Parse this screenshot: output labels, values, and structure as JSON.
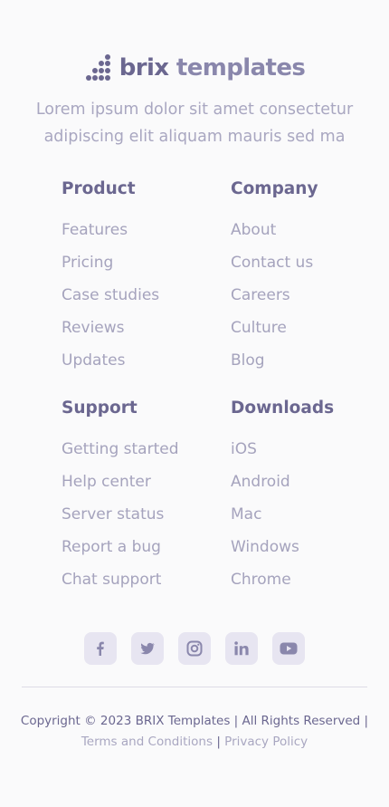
{
  "brand": {
    "word1": "brix",
    "word2": "templates"
  },
  "description": "Lorem ipsum dolor sit amet consectetur adipiscing elit aliquam mauris sed ma",
  "columns": [
    {
      "title": "Product",
      "links": [
        "Features",
        "Pricing",
        "Case studies",
        "Reviews",
        "Updates"
      ]
    },
    {
      "title": "Company",
      "links": [
        "About",
        "Contact us",
        "Careers",
        "Culture",
        "Blog"
      ]
    },
    {
      "title": "Support",
      "links": [
        "Getting started",
        "Help center",
        "Server status",
        "Report a bug",
        "Chat support"
      ]
    },
    {
      "title": "Downloads",
      "links": [
        "iOS",
        "Android",
        "Mac",
        "Windows",
        "Chrome"
      ]
    }
  ],
  "social": [
    "facebook-icon",
    "twitter-icon",
    "instagram-icon",
    "linkedin-icon",
    "youtube-icon"
  ],
  "copyright": "Copyright © 2023 BRIX Templates | All Rights Reserved |",
  "legal": {
    "terms": "Terms and Conditions",
    "separator": "|",
    "privacy": "Privacy Policy"
  },
  "colors": {
    "heading": "#6b6790",
    "text": "#a5a3bd",
    "icon_bg": "#e7e5f1",
    "background": "#fafafb"
  }
}
